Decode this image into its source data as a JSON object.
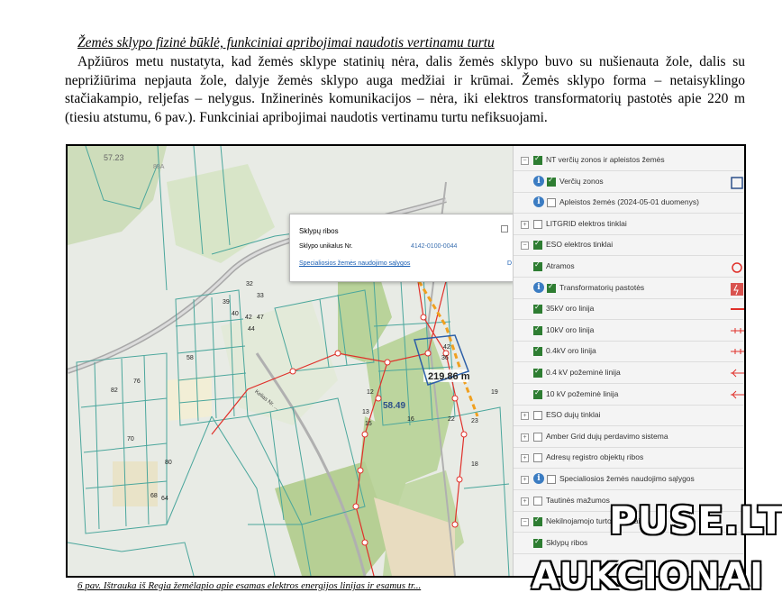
{
  "doc": {
    "heading": "Žemės sklypo fizinė būklė, funkciniai apribojimai naudotis vertinamu turtu",
    "paragraph": "Apžiūros metu nustatyta, kad žemės sklype statinių nėra, dalis žemės sklypo buvo su nušienauta žole, dalis su neprižiūrima nepjauta žole, dalyje žemės sklypo auga medžiai ir krūmai. Žemės sklypo forma – netaisyklingo stačiakampio, reljefas – nelygus. Inžinerinės komunikacijos – nėra, iki elektros transformatorių pastotės apie 220 m (tiesiu atstumu, 6 pav.). Funkciniai apribojimai naudotis vertinamu turtu nefiksuojami.",
    "caption": "6 pav. Ištrauka iš Regia žemėlapio apie esamas elektros energijos linijas ir esamus tr..."
  },
  "map": {
    "popup": {
      "title": "Sklypų ribos",
      "label": "Sklypo unikalus Nr.",
      "value": "4142-0100-0044",
      "link": "Specialiosios žemės naudojimo sąlygos",
      "more": "D"
    },
    "measure": "219.86 m",
    "area_label": "58.49",
    "road_label": "Kelias Nr. ...",
    "parcel_numbers": [
      "57.23",
      "88A",
      "58",
      "39",
      "40",
      "42",
      "47",
      "44",
      "32",
      "33",
      "76",
      "82",
      "70",
      "80",
      "68",
      "64",
      "12",
      "13",
      "15",
      "16",
      "18",
      "22",
      "23",
      "42",
      "36",
      "19"
    ],
    "legend": [
      {
        "level": 0,
        "toggle": "−",
        "checked": true,
        "info": false,
        "label": "NT verčių zonos ir apleistos žemės"
      },
      {
        "level": 1,
        "toggle": "",
        "checked": true,
        "info": true,
        "label": "Verčių zonos",
        "symbol": "square-outline"
      },
      {
        "level": 1,
        "toggle": "",
        "checked": false,
        "info": true,
        "label": "Apleistos žemės (2024-05-01 duomenys)"
      },
      {
        "level": 0,
        "toggle": "+",
        "checked": false,
        "info": false,
        "label": "LITGRID elektros tinklai"
      },
      {
        "level": 0,
        "toggle": "−",
        "checked": true,
        "info": false,
        "label": "ESO elektros tinklai"
      },
      {
        "level": 1,
        "toggle": "",
        "checked": true,
        "info": false,
        "label": "Atramos",
        "symbol": "red-circle"
      },
      {
        "level": 1,
        "toggle": "",
        "checked": true,
        "info": true,
        "label": "Transformatorių pastotės",
        "symbol": "transformer"
      },
      {
        "level": 1,
        "toggle": "",
        "checked": true,
        "info": false,
        "label": "35kV oro linija",
        "symbol": "red-line"
      },
      {
        "level": 1,
        "toggle": "",
        "checked": true,
        "info": false,
        "label": "10kV oro linija",
        "symbol": "red-line-ticks"
      },
      {
        "level": 1,
        "toggle": "",
        "checked": true,
        "info": false,
        "label": "0.4kV oro linija",
        "symbol": "red-line-ticks"
      },
      {
        "level": 1,
        "toggle": "",
        "checked": true,
        "info": false,
        "label": "0.4 kV požeminė linija",
        "symbol": "red-line-arrow"
      },
      {
        "level": 1,
        "toggle": "",
        "checked": true,
        "info": false,
        "label": "10 kV požeminė linija",
        "symbol": "red-line-arrow"
      },
      {
        "level": 0,
        "toggle": "+",
        "checked": false,
        "info": false,
        "label": "ESO dujų tinklai"
      },
      {
        "level": 0,
        "toggle": "+",
        "checked": false,
        "info": false,
        "label": "Amber Grid dujų perdavimo sistema"
      },
      {
        "level": 0,
        "toggle": "+",
        "checked": false,
        "info": false,
        "label": "Adresų registro objektų ribos"
      },
      {
        "level": 0,
        "toggle": "+",
        "checked": false,
        "info": true,
        "label": "Specialiosios žemės naudojimo sąlygos"
      },
      {
        "level": 0,
        "toggle": "+",
        "checked": false,
        "info": false,
        "label": "Tautinės mažumos"
      },
      {
        "level": 0,
        "toggle": "−",
        "checked": true,
        "info": false,
        "label": "Nekilnojamojo turto objektai"
      },
      {
        "level": 1,
        "toggle": "",
        "checked": true,
        "info": false,
        "label": "Sklypų ribos"
      }
    ]
  },
  "watermark": {
    "line1": "PUSE.LT",
    "line2": "AUKCIONAI"
  },
  "colors": {
    "parcel_line": "#4aa69c",
    "road": "#9a9a9a",
    "electric": "#e0302a",
    "highlight": "#f0a020",
    "forest": "#b9d39a"
  }
}
